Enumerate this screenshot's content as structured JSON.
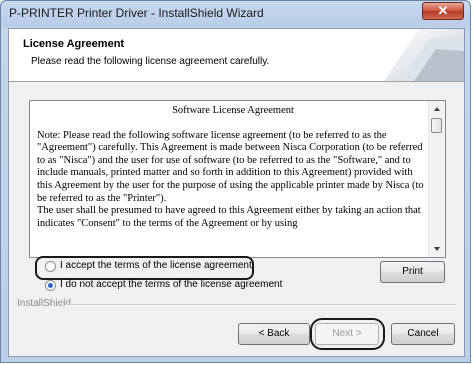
{
  "window": {
    "title": "P-PRINTER Printer Driver - InstallShield Wizard",
    "close_label": "✕"
  },
  "header": {
    "title": "License Agreement",
    "subtitle": "Please read the following license agreement carefully."
  },
  "license": {
    "heading": "Software License Agreement",
    "paragraph1": "Note: Please read the following software license agreement (to be referred to as the \"Agreement\") carefully.  This Agreement is made between Nisca Corporation (to be referred to as \"Nisca\") and the user for use of software (to be referred to as the \"Software,\" and to include manuals, printed matter and so forth in addition to this Agreement) provided with this Agreement by the user for the purpose of using the applicable printer made by Nisca (to be referred to as the \"Printer\").",
    "paragraph2": "The user shall be presumed to have agreed to this Agreement either by taking an action that indicates \"Consent\" to the terms of the Agreement or by using"
  },
  "options": {
    "accept_label": "I accept the terms of the license agreement",
    "decline_label": "I do not accept the terms of the license agreement",
    "selected": "decline"
  },
  "buttons": {
    "print": "Print",
    "back": "< Back",
    "next": "Next >",
    "cancel": "Cancel"
  },
  "footer": {
    "brand": "InstallShield"
  },
  "colors": {
    "titlebar": "#c7d8ee",
    "close_button": "#c9533c",
    "radio_selected": "#2c64c8"
  }
}
